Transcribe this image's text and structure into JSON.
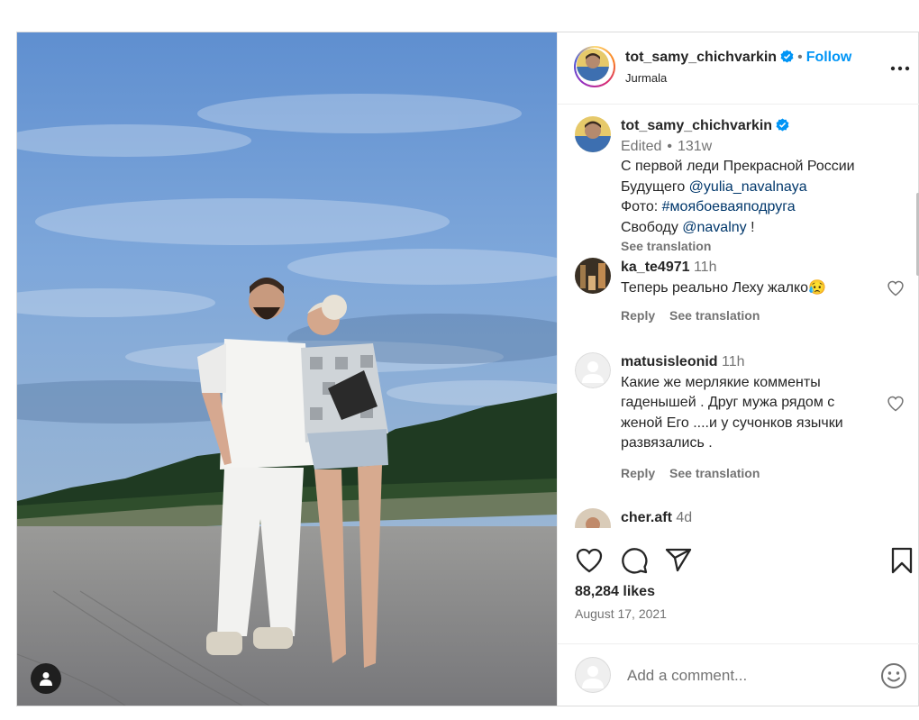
{
  "post": {
    "username": "tot_samy_chichvarkin",
    "follow_label": "Follow",
    "separator": "•",
    "location": "Jurmala"
  },
  "caption": {
    "username": "tot_samy_chichvarkin",
    "edited": "Edited",
    "separator": "•",
    "time": "131w",
    "line1": "С первой леди Прекрасной России",
    "line2_text": "Будущего ",
    "line2_mention": "@yulia_navalnaya",
    "line3_text": "Фото: ",
    "line3_hashtag": "#моябоеваяподруга",
    "line4_text": "Свободу ",
    "line4_mention": "@navalny",
    "line4_end": " !",
    "see_translation": "See translation"
  },
  "comments": [
    {
      "username": "ka_te4971",
      "time": "11h",
      "text": "Теперь реально Леху жалко",
      "emoji": "😥",
      "reply_label": "Reply",
      "translate_label": "See translation"
    },
    {
      "username": "matusisleonid",
      "time": "11h",
      "text": "Какие же мерлякие комменты гаденышей . Друг мужа рядом с женой Его ....и у сучонков язычки развязались .",
      "reply_label": "Reply",
      "translate_label": "See translation"
    },
    {
      "username": "cher.aft",
      "time": "4d"
    }
  ],
  "stats": {
    "likes": "88,284 likes",
    "date": "August 17, 2021"
  },
  "add_comment": {
    "placeholder": "Add a comment..."
  },
  "icons": {
    "like": "heart-icon",
    "comment": "comment-bubble-icon",
    "share": "paper-plane-icon",
    "save": "bookmark-icon",
    "emoji": "smiley-icon",
    "tag": "user-tag-icon",
    "more": "ellipsis-icon"
  },
  "colors": {
    "link": "#00376b",
    "follow": "#0095f6",
    "muted": "#737373",
    "verified": "#0095f6"
  }
}
